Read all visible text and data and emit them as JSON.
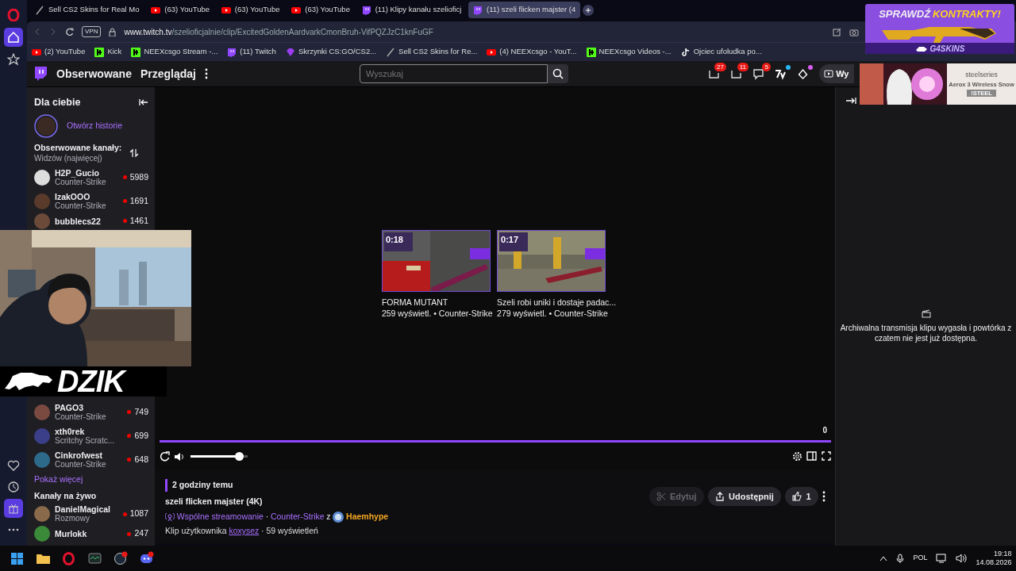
{
  "browser": {
    "sidebar_top": [
      {
        "kind": "opera",
        "selected": false
      },
      {
        "kind": "home",
        "selected": true
      },
      {
        "kind": "star",
        "selected": false
      }
    ],
    "sidebar_bottom": [
      {
        "kind": "heart",
        "selected": false
      },
      {
        "kind": "clock",
        "selected": false
      },
      {
        "kind": "gift",
        "selected": true
      },
      {
        "kind": "dots",
        "selected": false
      }
    ],
    "tabs": [
      {
        "label": "Sell CS2 Skins for Real Mo",
        "kind": "slash",
        "selected": false
      },
      {
        "label": "(63) YouTube",
        "kind": "youtube",
        "selected": false
      },
      {
        "label": "(63) YouTube",
        "kind": "youtube",
        "selected": false
      },
      {
        "label": "(63) YouTube",
        "kind": "youtube",
        "selected": false
      },
      {
        "label": "(11) Klipy kanału szelioficj",
        "kind": "twitch",
        "selected": false
      },
      {
        "label": "(11) szeli flicken majster (4",
        "kind": "twitch",
        "selected": true
      }
    ],
    "vpn": "VPN",
    "address": {
      "domain": "www.twitch.tv",
      "path": "/szelioficjalnie/clip/ExcitedGoldenAardvarkCmonBruh-VifPQZJzC1knFuGF"
    },
    "bookmarks": [
      {
        "label": "(2) YouTube",
        "kind": "youtube"
      },
      {
        "label": "Kick",
        "kind": "kick"
      },
      {
        "label": "NEEXcsgo Stream -...",
        "kind": "kick"
      },
      {
        "label": "(11) Twitch",
        "kind": "twitch"
      },
      {
        "label": "Skrzynki CS:GO/CS2...",
        "kind": "gem"
      },
      {
        "label": "Sell CS2 Skins for Re...",
        "kind": "slash"
      },
      {
        "label": "(4) NEEXcsgo - YouT...",
        "kind": "youtube"
      },
      {
        "label": "NEEXcsgo Videos -...",
        "kind": "kick"
      },
      {
        "label": "Ojciec ufoludka po...",
        "kind": "tiktok"
      }
    ]
  },
  "nav": {
    "links": [
      "Obserwowane",
      "Przeglądaj"
    ],
    "search_placeholder": "Wyszukaj",
    "badges": [
      {
        "kind": "inbox",
        "count": "27"
      },
      {
        "kind": "inbox",
        "count": "11"
      },
      {
        "kind": "chat",
        "count": "5"
      },
      {
        "kind": "seven"
      },
      {
        "kind": "drop"
      }
    ],
    "button_label": "Wy"
  },
  "sidebar": {
    "title": "Dla ciebie",
    "story_link": "Otwórz historie",
    "followed_title": "Obserwowane kanały:",
    "sort": "Widzów (najwięcej)",
    "channels_top": [
      {
        "name": "H2P_Gucio",
        "category": "Counter-Strike",
        "viewers": "5989"
      },
      {
        "name": "IzakOOO",
        "category": "Counter-Strike",
        "viewers": "1691"
      },
      {
        "name": "bubblecs22",
        "viewers": "1461"
      }
    ],
    "channels_bottom": [
      {
        "name": "PAGO3",
        "category": "Counter-Strike",
        "viewers": "749"
      },
      {
        "name": "xth0rek",
        "category": "Scritchy Scratc...",
        "viewers": "699"
      },
      {
        "name": "Cinkrofwest",
        "category": "Counter-Strike",
        "viewers": "648"
      }
    ],
    "show_more": "Pokaż więcej",
    "live_title": "Kanały na żywo",
    "live_channels": [
      {
        "name": "DanielMagical",
        "category": "Rozmowy",
        "viewers": "1087"
      },
      {
        "name": "Murlokk",
        "viewers": "247"
      }
    ]
  },
  "player": {
    "clips": [
      {
        "duration": "0:18",
        "title": "FORMA MUTANT",
        "meta": "259 wyświetl. • Counter-Strike"
      },
      {
        "duration": "0:17",
        "title": "Szeli robi uniki i dostaje padac...",
        "meta": "279 wyświetl. • Counter-Strike"
      }
    ],
    "time": "0",
    "progress": {
      "level": 1
    },
    "volume": {
      "level": 0.85
    }
  },
  "clip_info": {
    "age": "2 godziny temu",
    "title": "szeli flicken majster (4K)",
    "shared": "Wspólne streamowanie",
    "separator": "·",
    "category": "Counter-Strike",
    "joiner": "z",
    "partner": "Haemhype",
    "clipper_prefix": "Klip użytkownika",
    "clipper": "koxysez",
    "views": "· 59 wyświetleń",
    "buttons": [
      {
        "kind": "edit",
        "label": "Edytuj",
        "disabled": true
      },
      {
        "kind": "share",
        "label": "Udostępnij",
        "disabled": false
      },
      {
        "kind": "like",
        "label": "1",
        "disabled": false
      }
    ]
  },
  "chat": {
    "message": "Archiwalna transmisja klipu wygasła i powtórka z czatem nie jest już dostępna."
  },
  "overlays": {
    "logo": "DZIK",
    "contract_ad": {
      "word_a": "SPRAWDŹ",
      "word_b": "KONTRAKTY!",
      "brand": "G4SKINS"
    },
    "mouse_ad": {
      "brand": "steelseries",
      "product": "Aerox 3 Wireless Snow",
      "code": "!STEEL"
    }
  },
  "taskbar": {
    "language": "POL",
    "time": "19:18",
    "date": "14.08.2026"
  }
}
